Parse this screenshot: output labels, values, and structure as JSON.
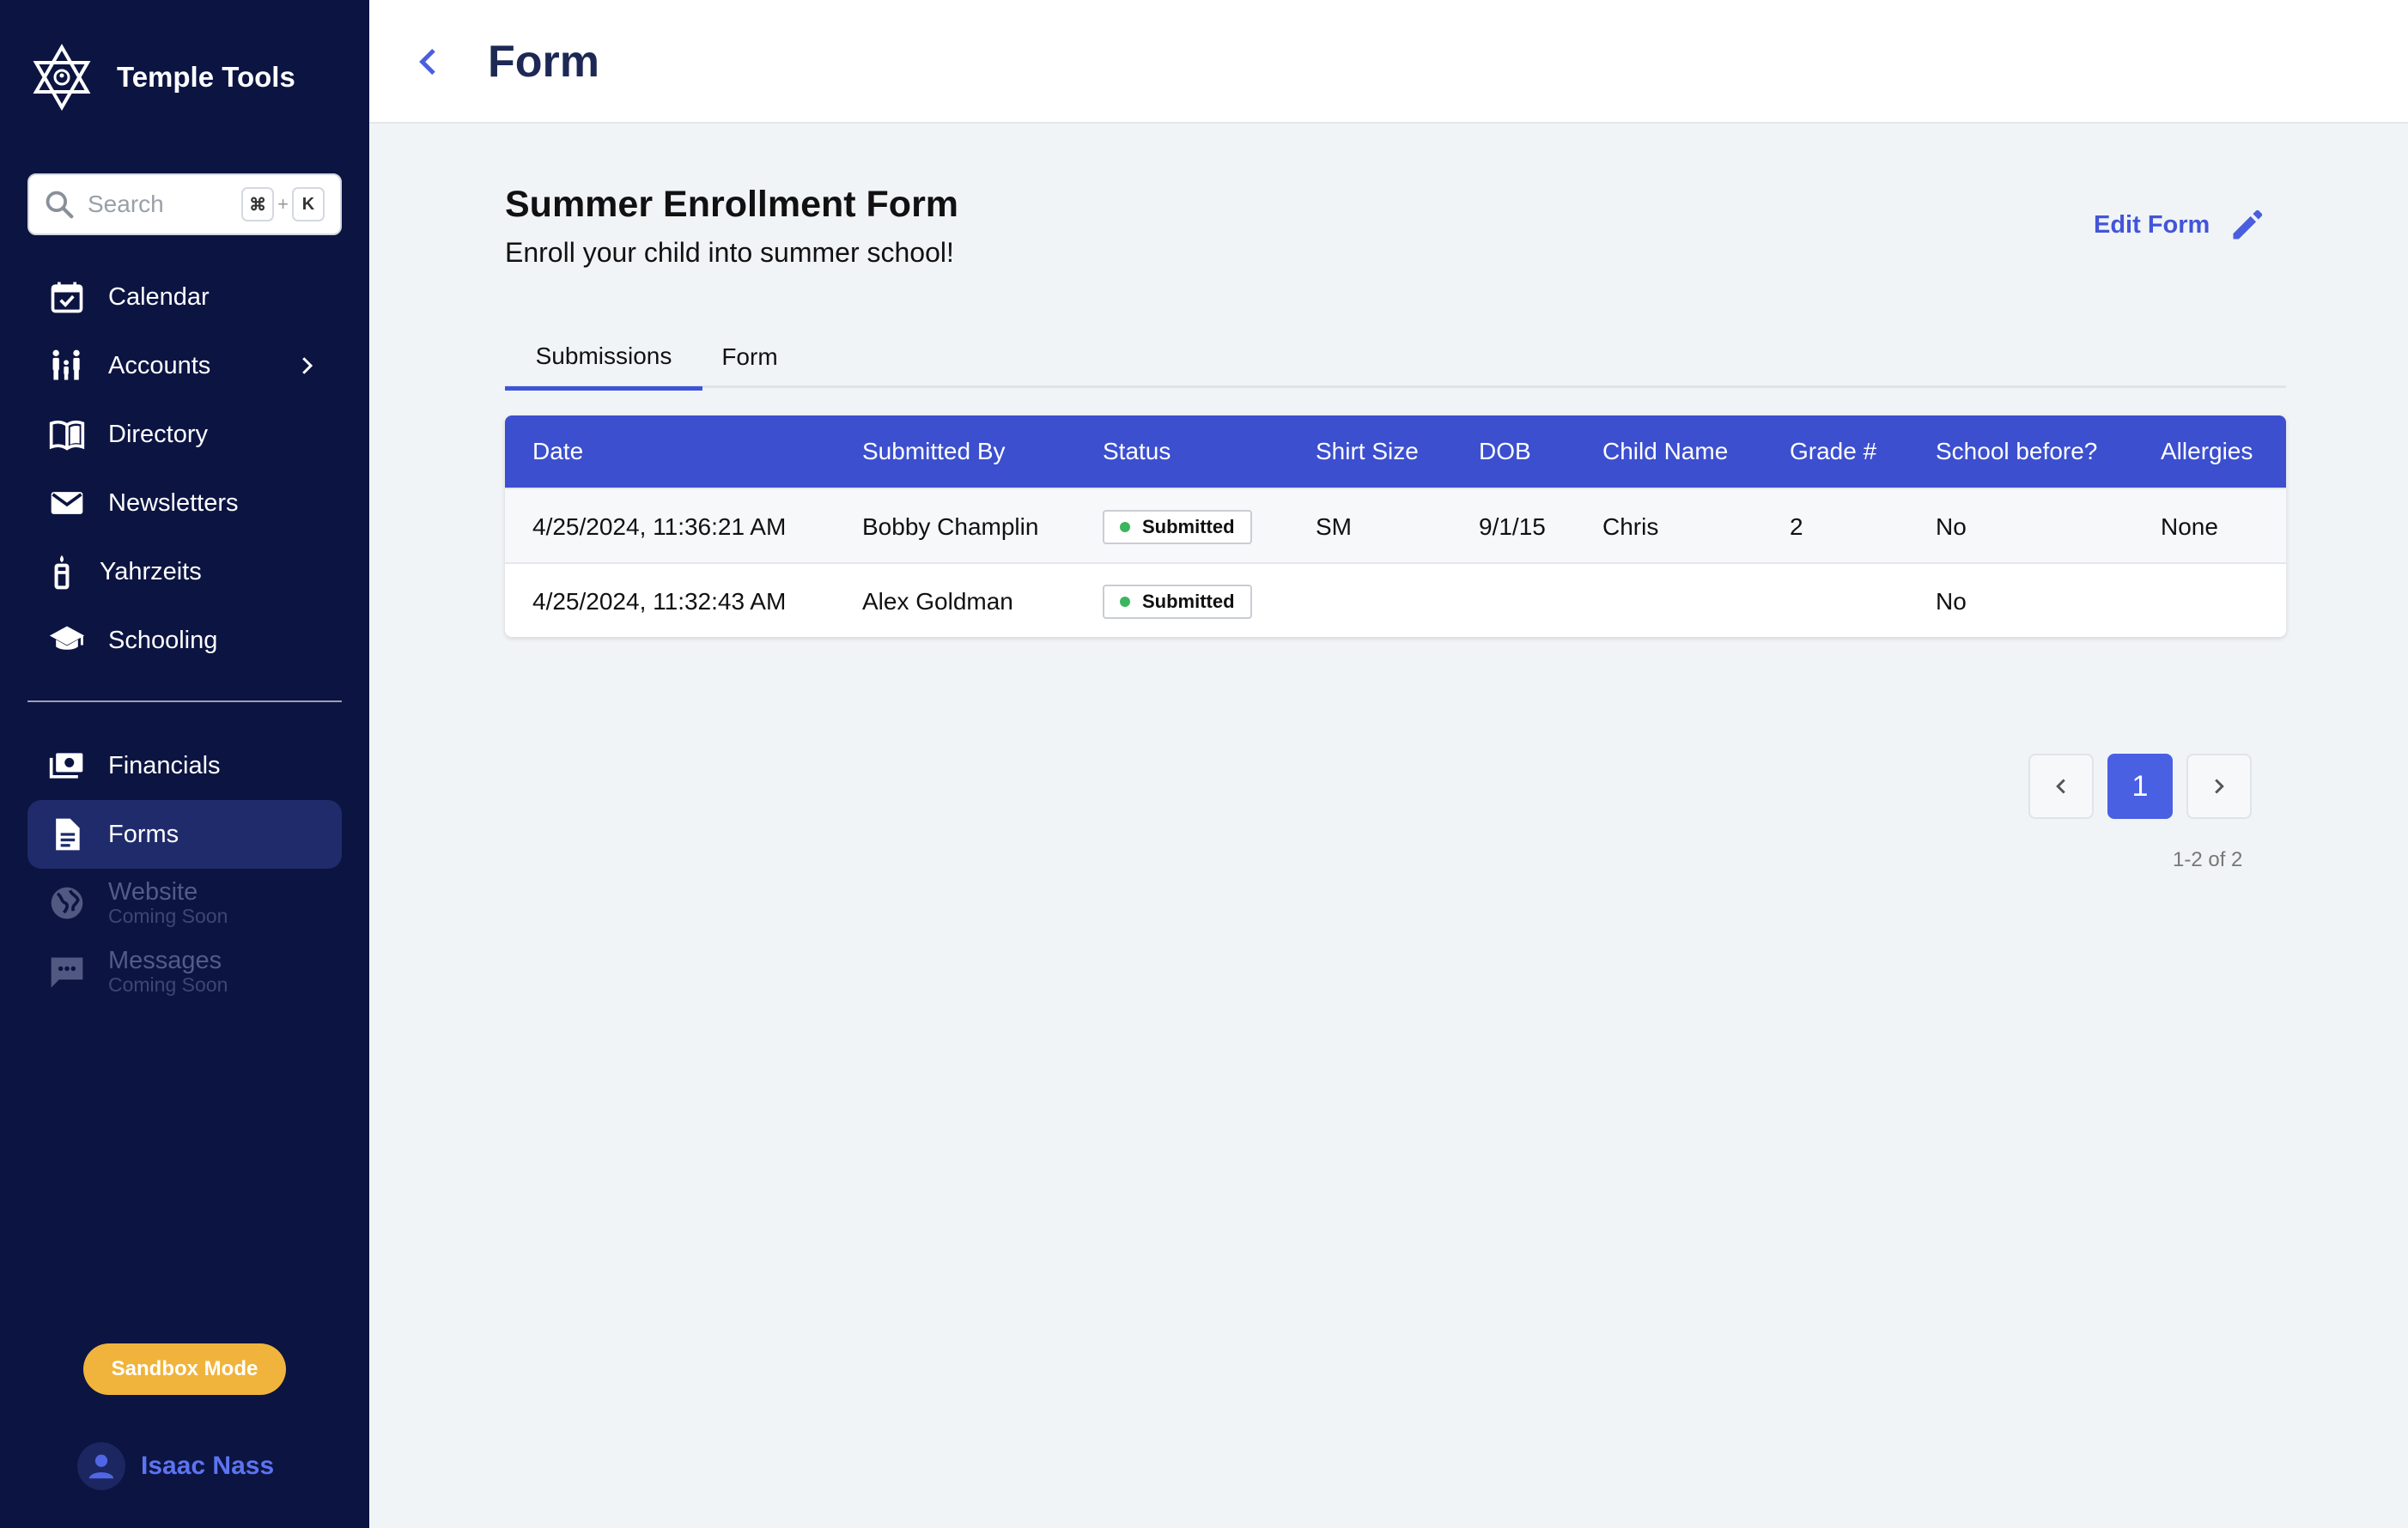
{
  "app": {
    "name": "Temple Tools"
  },
  "search": {
    "placeholder": "Search",
    "key_modifier": "⌘",
    "key_plus": "+",
    "key": "K"
  },
  "sidebar": {
    "items": [
      {
        "label": "Calendar",
        "icon": "calendar-check-icon"
      },
      {
        "label": "Accounts",
        "icon": "family-icon"
      },
      {
        "label": "Directory",
        "icon": "book-icon"
      },
      {
        "label": "Newsletters",
        "icon": "mail-icon"
      },
      {
        "label": "Yahrzeits",
        "icon": "candle-icon"
      },
      {
        "label": "Schooling",
        "icon": "graduation-cap-icon"
      }
    ],
    "secondary": [
      {
        "label": "Financials",
        "icon": "money-icon"
      },
      {
        "label": "Forms",
        "icon": "document-icon",
        "active": true
      },
      {
        "label": "Website",
        "sub": "Coming Soon",
        "icon": "globe-icon"
      },
      {
        "label": "Messages",
        "sub": "Coming Soon",
        "icon": "chat-icon"
      }
    ],
    "sandbox_label": "Sandbox Mode",
    "user_name": "Isaac Nass"
  },
  "header": {
    "title": "Form"
  },
  "form": {
    "title": "Summer Enrollment Form",
    "description": "Enroll your child into summer school!",
    "edit_label": "Edit Form"
  },
  "tabs": [
    {
      "label": "Submissions",
      "active": true
    },
    {
      "label": "Form",
      "active": false
    }
  ],
  "table": {
    "columns": [
      "Date",
      "Submitted By",
      "Status",
      "Shirt Size",
      "DOB",
      "Child Name",
      "Grade #",
      "School before?",
      "Allergies"
    ],
    "rows": [
      [
        "4/25/2024, 11:36:21 AM",
        "Bobby Champlin",
        "Submitted",
        "SM",
        "9/1/15",
        "Chris",
        "2",
        "No",
        "None"
      ],
      [
        "4/25/2024, 11:32:43 AM",
        "Alex Goldman",
        "Submitted",
        "",
        "",
        "",
        "",
        "No",
        ""
      ]
    ]
  },
  "pagination": {
    "current": "1",
    "range": "1-2 of 2"
  },
  "colors": {
    "sidebar_bg": "#0c1442",
    "accent": "#3b4fcf",
    "sandbox": "#f0b43c",
    "status_ok": "#3cb55e"
  }
}
